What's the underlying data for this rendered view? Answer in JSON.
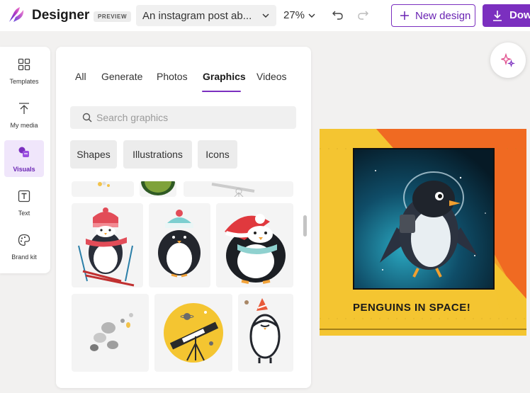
{
  "header": {
    "app_title": "Designer",
    "preview_badge": "PREVIEW",
    "design_title": "An instagram post ab...",
    "zoom": "27%",
    "new_design_label": "New design",
    "download_label": "Download"
  },
  "rail": {
    "items": [
      {
        "label": "Templates",
        "icon": "templates-icon"
      },
      {
        "label": "My media",
        "icon": "upload-icon"
      },
      {
        "label": "Visuals",
        "icon": "visuals-icon",
        "active": true
      },
      {
        "label": "Text",
        "icon": "text-icon"
      },
      {
        "label": "Brand kit",
        "icon": "palette-icon"
      }
    ]
  },
  "panel": {
    "tabs": [
      {
        "label": "All"
      },
      {
        "label": "Generate"
      },
      {
        "label": "Photos"
      },
      {
        "label": "Graphics",
        "active": true
      },
      {
        "label": "Videos"
      }
    ],
    "search_placeholder": "Search graphics",
    "chips": [
      "Shapes",
      "Illustrations",
      "Icons"
    ]
  },
  "canvas": {
    "caption": "PENGUINS IN SPACE!"
  },
  "colors": {
    "accent": "#7b2fbf",
    "post_yellow": "#f4c531",
    "post_orange": "#f06a22"
  }
}
